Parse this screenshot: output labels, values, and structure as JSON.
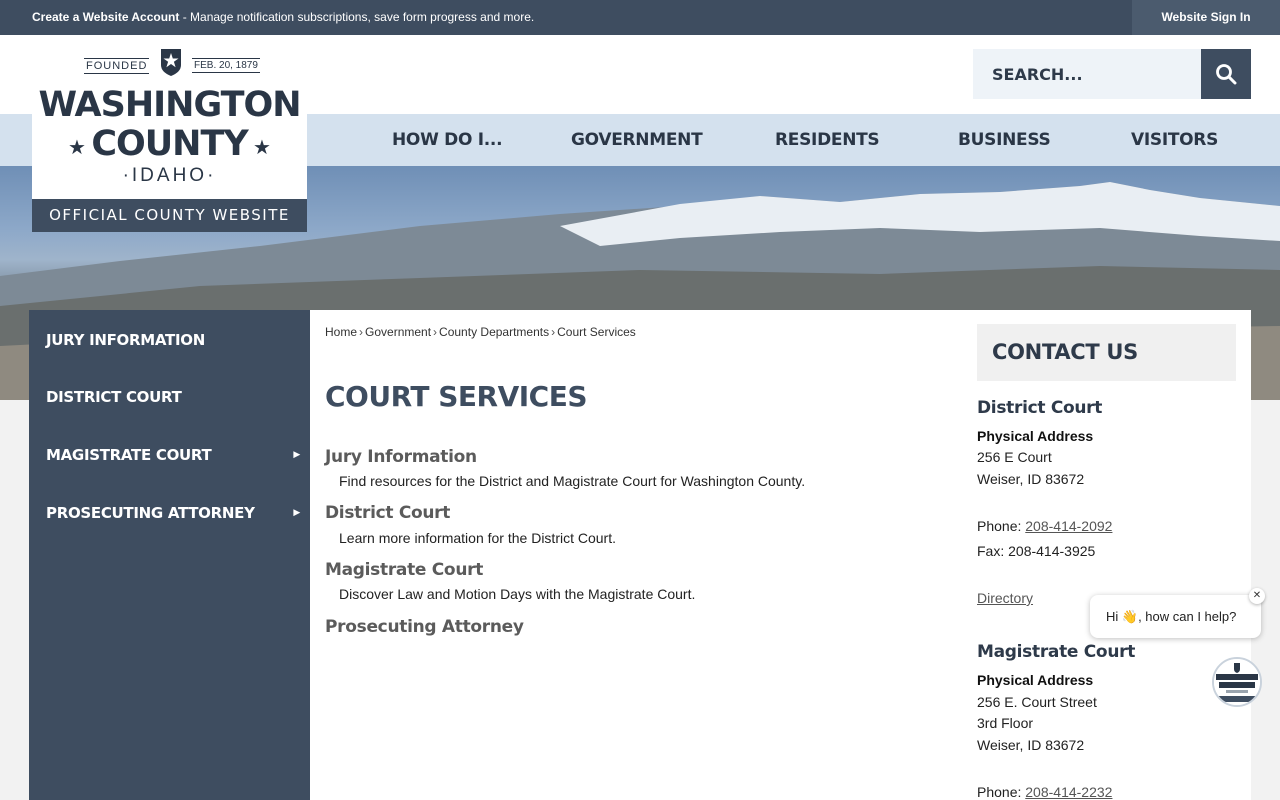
{
  "topbar": {
    "notice_bold": "Create a Website Account",
    "notice_rest": " - Manage notification subscriptions, save form progress and more.",
    "signin": "Website Sign In"
  },
  "logo": {
    "founded": "FOUNDED",
    "date": "FEB. 20, 1879",
    "line1": "WASHINGTON",
    "line2": "COUNTY",
    "state": "·IDAHO·",
    "official": "OFFICIAL COUNTY WEBSITE",
    "star": "★"
  },
  "search": {
    "placeholder": "SEARCH..."
  },
  "nav": [
    "HOW DO I...",
    "GOVERNMENT",
    "RESIDENTS",
    "BUSINESS",
    "VISITORS"
  ],
  "sidebar": [
    {
      "label": "JURY INFORMATION",
      "arrow": ""
    },
    {
      "label": "DISTRICT COURT",
      "arrow": ""
    },
    {
      "label": "MAGISTRATE COURT",
      "arrow": "▶"
    },
    {
      "label": "PROSECUTING ATTORNEY",
      "arrow": "▶"
    }
  ],
  "breadcrumb": [
    "Home",
    "Government",
    "County Departments",
    "Court Services"
  ],
  "breadcrumb_sep": "›",
  "page_title": "COURT SERVICES",
  "entries": [
    {
      "title": "Jury Information",
      "desc": "Find resources for the District and Magistrate Court for Washington County."
    },
    {
      "title": "District Court",
      "desc": "Learn more information for the District Court."
    },
    {
      "title": "Magistrate Court",
      "desc": "Discover Law and Motion Days with the Magistrate Court."
    },
    {
      "title": "Prosecuting Attorney",
      "desc": ""
    }
  ],
  "contact": {
    "heading": "CONTACT US",
    "district": {
      "title": "District Court",
      "addr_label": "Physical Address",
      "addr1": "256 E Court",
      "addr2": "Weiser, ID 83672",
      "phone_label": "Phone: ",
      "phone": "208-414-2092",
      "fax": "Fax: 208-414-3925",
      "directory": "Directory"
    },
    "magistrate": {
      "title": "Magistrate Court",
      "addr_label": "Physical Address",
      "addr1": "256 E. Court Street",
      "addr2": "3rd Floor",
      "addr3": "Weiser, ID 83672",
      "phone_label": "Phone: ",
      "phone": "208-414-2232"
    }
  },
  "chat": {
    "message": "Hi 👋, how can I help?",
    "close": "✕"
  },
  "colors": {
    "primary": "#3e4d60",
    "nav_bg": "#d4e1ee",
    "white": "#ffffff"
  }
}
